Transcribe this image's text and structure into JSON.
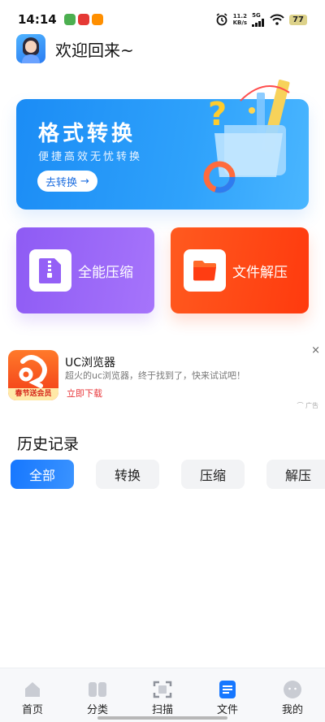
{
  "status_bar": {
    "time": "14:14",
    "net_speed_value": "11.2",
    "net_speed_unit": "KB/s",
    "network": "5G",
    "battery": "77"
  },
  "header": {
    "greeting": "欢迎回来~"
  },
  "banner": {
    "title": "格式转换",
    "subtitle": "便捷高效无忧转换",
    "button_label": "去转换",
    "button_arrow": "→"
  },
  "tiles": {
    "zip_label": "全能压缩",
    "unzip_label": "文件解压"
  },
  "ad": {
    "app_name": "UC浏览器",
    "description": "超火的uc浏览器，终于找到了，快来试试吧！",
    "cta": "立即下载",
    "icon_badge": "春节送会员",
    "close": "×",
    "tag": "广告"
  },
  "history": {
    "title": "历史记录",
    "filters": [
      {
        "label": "全部",
        "active": true
      },
      {
        "label": "转换",
        "active": false
      },
      {
        "label": "压缩",
        "active": false
      },
      {
        "label": "解压",
        "active": false
      }
    ]
  },
  "bottom_nav": [
    {
      "label": "首页",
      "icon": "home-icon",
      "active": false
    },
    {
      "label": "分类",
      "icon": "category-icon",
      "active": false
    },
    {
      "label": "扫描",
      "icon": "scan-icon",
      "active": false
    },
    {
      "label": "文件",
      "icon": "file-icon",
      "active": true
    },
    {
      "label": "我的",
      "icon": "profile-icon",
      "active": false
    }
  ],
  "colors": {
    "primary": "#1677ff",
    "zip_tile": "#9460f6",
    "unzip_tile": "#ff4a16",
    "ad_link": "#e8363a"
  }
}
